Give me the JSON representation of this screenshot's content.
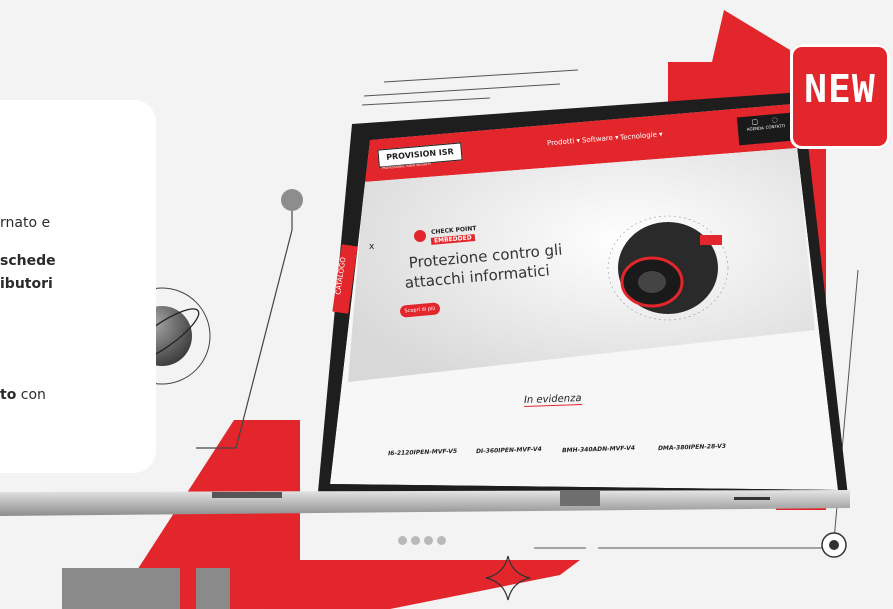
{
  "card": {
    "line1": "rnato e",
    "line2": "schede",
    "line3": "ibutori",
    "line4_bold": "to",
    "line4_rest": " con"
  },
  "badge": {
    "label": "NEW"
  },
  "screen": {
    "brand": "PROVISION ISR",
    "brand_tagline": "PROFESSIONAL VIDEO SECURITY",
    "nav": [
      "Prodotti ▾",
      "Software ▾",
      "Tecnologie ▾"
    ],
    "top_icons": [
      {
        "icon": "calendar-icon",
        "label": "AGENDA"
      },
      {
        "icon": "chat-icon",
        "label": "CONTATTI"
      }
    ],
    "catalog_tab": "CATALOGO",
    "catalog_close": "x",
    "checkpoint_line1": "CHECK POINT",
    "checkpoint_line2": "EMBEDDED",
    "hero_line1": "Protezione contro gli",
    "hero_line2": "attacchi informatici",
    "cta": "Scopri di più",
    "section_title": "In evidenza",
    "products": [
      "I6-2120IPEN-MVF-V5",
      "DI-360IPEN-MVF-V4",
      "BMH-340ADN-MVF-V4",
      "DMA-380IPEN-28-V3"
    ]
  },
  "colors": {
    "accent": "#e3262b",
    "dark": "#2b2b2b",
    "card": "#ffffff",
    "bg": "#f3f3f3"
  }
}
